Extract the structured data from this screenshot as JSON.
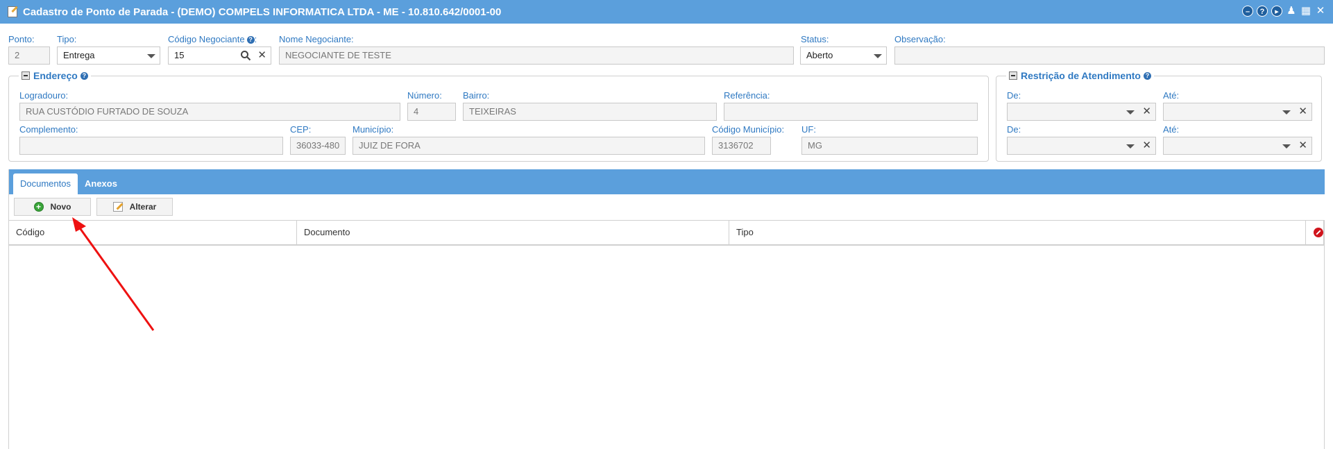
{
  "window": {
    "title": "Cadastro de Ponto de Parada - (DEMO) COMPELS INFORMATICA LTDA - ME - 10.810.642/0001-00",
    "controls": [
      "minimize-icon",
      "help-icon",
      "play-icon",
      "user-icon",
      "calendar-icon",
      "close-icon"
    ],
    "close_glyph": "✕"
  },
  "header": {
    "ponto_label": "Ponto:",
    "ponto_value": "2",
    "tipo_label": "Tipo:",
    "tipo_value": "Entrega",
    "codigo_negociante_label": "Código Negociante",
    "codigo_negociante_value": "15",
    "nome_negociante_label": "Nome Negociante:",
    "nome_negociante_value": "NEGOCIANTE DE TESTE",
    "status_label": "Status:",
    "status_value": "Aberto",
    "observacao_label": "Observação:",
    "observacao_value": ""
  },
  "endereco": {
    "legend": "Endereço",
    "logradouro_label": "Logradouro:",
    "logradouro_value": "RUA CUSTÓDIO FURTADO DE SOUZA",
    "numero_label": "Número:",
    "numero_value": "4",
    "bairro_label": "Bairro:",
    "bairro_value": "TEIXEIRAS",
    "referencia_label": "Referência:",
    "referencia_value": "",
    "complemento_label": "Complemento:",
    "complemento_value": "",
    "cep_label": "CEP:",
    "cep_value": "36033-480",
    "municipio_label": "Município:",
    "municipio_value": "JUIZ DE FORA",
    "codigo_municipio_label": "Código Município:",
    "codigo_municipio_value": "3136702",
    "uf_label": "UF:",
    "uf_value": "MG"
  },
  "restricao": {
    "legend": "Restrição de Atendimento",
    "de1_label": "De:",
    "ate1_label": "Até:",
    "de2_label": "De:",
    "ate2_label": "Até:"
  },
  "tabs": [
    {
      "label": "Documentos",
      "active": true
    },
    {
      "label": "Anexos",
      "active": false
    }
  ],
  "toolbar": {
    "novo_label": "Novo",
    "alterar_label": "Alterar"
  },
  "grid": {
    "columns": [
      "Código",
      "Documento",
      "Tipo"
    ]
  },
  "colors": {
    "accent": "#5b9fdc",
    "label": "#2f79c2",
    "annotation_arrow": "#ee1111"
  }
}
